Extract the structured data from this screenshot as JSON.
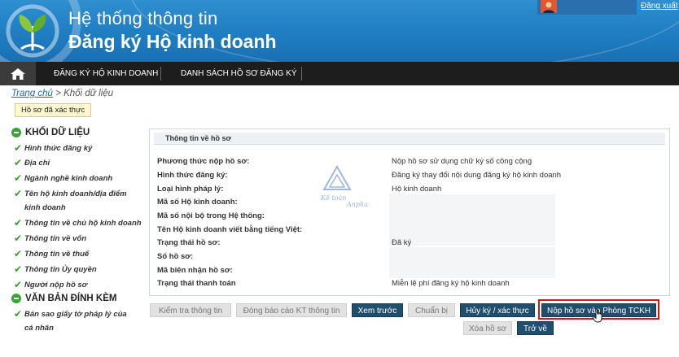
{
  "header": {
    "title_line1": "Hệ thống thông tin",
    "title_line2": "Đăng ký Hộ kinh doanh",
    "logout": "Đăng xuất"
  },
  "nav": {
    "items": [
      "ĐĂNG KÝ HỘ KINH DOANH",
      "DANH SÁCH HỒ SƠ ĐĂNG KÝ"
    ]
  },
  "breadcrumb": {
    "home": "Trang chủ",
    "separator": ">",
    "current": "Khối dữ liệu"
  },
  "status_badge": "Hồ sơ đã xác thực",
  "sidebar": {
    "section1": "KHỐI DỮ LIỆU",
    "items": [
      "Hình thức đăng ký",
      "Địa chỉ",
      "Ngành nghề kinh doanh",
      "Tên hộ kinh doanh/địa điểm kinh doanh",
      "Thông tin về chủ hộ kinh doanh",
      "Thông tin về vốn",
      "Thông tin về thuế",
      "Thông tin Ủy quyền",
      "Người nộp hồ sơ"
    ],
    "section2": "VĂN BẢN ĐÍNH KÈM",
    "attachments": [
      "Bản sao giấy tờ pháp lý của cá nhân"
    ]
  },
  "panel": {
    "title": "Thông tin về hồ sơ",
    "rows": [
      {
        "label": "Phương thức nộp hồ sơ:",
        "value": "Nộp hồ sơ sử dụng chữ ký số công cộng"
      },
      {
        "label": "Hình thức đăng ký:",
        "value": "Đăng ký thay đổi nội dung đăng ký hộ kinh doanh"
      },
      {
        "label": "Loại hình pháp lý:",
        "value": "Hộ kinh doanh"
      },
      {
        "label": "Mã số Hộ kinh doanh:",
        "value": ""
      },
      {
        "label": "Mã số nội bộ trong Hệ thống:",
        "value": ""
      },
      {
        "label": "Tên Hộ kinh doanh viết bằng tiếng Việt:",
        "value": ""
      },
      {
        "label": "Trạng thái hồ sơ:",
        "value": "Đã ký"
      },
      {
        "label": "Số hồ sơ:",
        "value": ""
      },
      {
        "label": "Mã biên nhận hồ sơ:",
        "value": ""
      },
      {
        "label": "Trạng thái thanh toán",
        "value": "Miễn lệ phí đăng ký hộ kinh doanh"
      }
    ]
  },
  "watermark": {
    "line1": "Kế toán",
    "line2": "Anpha"
  },
  "buttons": {
    "check": "Kiểm tra thông tin",
    "report": "Đóng báo cáo KT thông tin",
    "preview": "Xem trước",
    "prepare": "Chuẩn bị",
    "cancel_sign": "Hủy ký / xác thực",
    "submit": "Nộp hồ sơ vào Phòng TCKH",
    "delete": "Xóa hồ sơ",
    "back": "Trở về"
  },
  "colors": {
    "header_blue": "#1f7dc2",
    "nav_dark": "#1d1d1d",
    "button_dark": "#1f4f6d",
    "check_green": "#3b9b2e",
    "highlight_red": "#d9141c"
  }
}
